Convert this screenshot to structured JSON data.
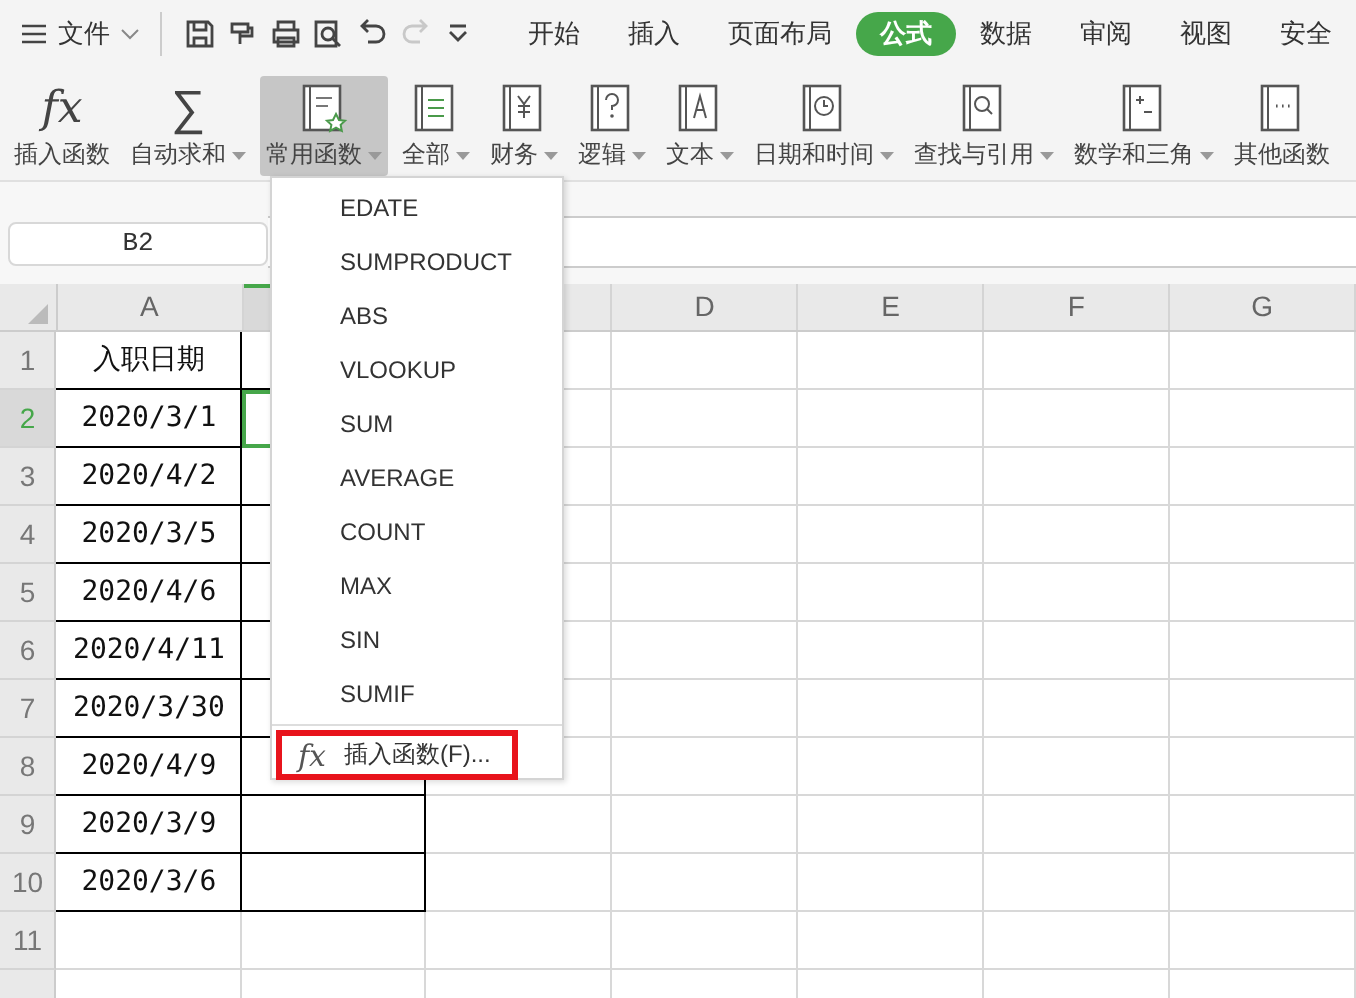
{
  "menu": {
    "label": "文件"
  },
  "quick_access": [
    {
      "kind": "save",
      "disabled": false
    },
    {
      "kind": "painter",
      "disabled": false
    },
    {
      "kind": "print",
      "disabled": false
    },
    {
      "kind": "preview",
      "disabled": false
    },
    {
      "kind": "undo",
      "disabled": false
    },
    {
      "kind": "redo",
      "disabled": true
    },
    {
      "kind": "more",
      "disabled": false
    }
  ],
  "tabs": [
    {
      "label": "开始",
      "selected": false
    },
    {
      "label": "插入",
      "selected": false
    },
    {
      "label": "页面布局",
      "selected": false
    },
    {
      "label": "公式",
      "selected": true
    },
    {
      "label": "数据",
      "selected": false
    },
    {
      "label": "审阅",
      "selected": false
    },
    {
      "label": "视图",
      "selected": false
    },
    {
      "label": "安全",
      "selected": false
    }
  ],
  "ribbon": [
    {
      "kind": "fx",
      "glyph": "fx",
      "label": "插入函数",
      "dropdown": false,
      "selected": false
    },
    {
      "kind": "sum",
      "glyph": "∑",
      "label": "自动求和",
      "dropdown": true,
      "selected": false
    },
    {
      "kind": "common",
      "label": "常用函数",
      "dropdown": true,
      "selected": true
    },
    {
      "kind": "all",
      "label": "全部",
      "dropdown": true,
      "selected": false
    },
    {
      "kind": "finance",
      "label": "财务",
      "dropdown": true,
      "selected": false
    },
    {
      "kind": "logic",
      "label": "逻辑",
      "dropdown": true,
      "selected": false
    },
    {
      "kind": "text",
      "label": "文本",
      "dropdown": true,
      "selected": false
    },
    {
      "kind": "datetime",
      "label": "日期和时间",
      "dropdown": true,
      "selected": false
    },
    {
      "kind": "lookup",
      "label": "查找与引用",
      "dropdown": true,
      "selected": false
    },
    {
      "kind": "math",
      "label": "数学和三角",
      "dropdown": true,
      "selected": false
    },
    {
      "kind": "other",
      "label": "其他函数",
      "dropdown": false,
      "selected": false
    }
  ],
  "name_box": {
    "value": "B2"
  },
  "sheet": {
    "columns": [
      {
        "label": "A",
        "selected": false
      },
      {
        "selected": true
      },
      {
        "selected": false
      },
      {
        "label": "D",
        "selected": false
      },
      {
        "label": "E",
        "selected": false
      },
      {
        "label": "F",
        "selected": false
      },
      {
        "label": "G",
        "selected": false
      }
    ],
    "rows": [
      {
        "label": "1",
        "selected": false,
        "cells": [
          "入职日期"
        ]
      },
      {
        "label": "2",
        "selected": true,
        "cells": [
          "2020/3/1"
        ]
      },
      {
        "label": "3",
        "selected": false,
        "cells": [
          "2020/4/2"
        ]
      },
      {
        "label": "4",
        "selected": false,
        "cells": [
          "2020/3/5"
        ]
      },
      {
        "label": "5",
        "selected": false,
        "cells": [
          "2020/4/6"
        ]
      },
      {
        "label": "6",
        "selected": false,
        "cells": [
          "2020/4/11"
        ]
      },
      {
        "label": "7",
        "selected": false,
        "cells": [
          "2020/3/30"
        ]
      },
      {
        "label": "8",
        "selected": false,
        "cells": [
          "2020/4/9"
        ]
      },
      {
        "label": "9",
        "selected": false,
        "cells": [
          "2020/3/9"
        ]
      },
      {
        "label": "10",
        "selected": false,
        "cells": [
          "2020/3/6"
        ]
      },
      {
        "label": "11",
        "selected": false,
        "cells": []
      },
      {
        "selected": false,
        "cells": []
      }
    ]
  },
  "dropdown": {
    "items": [
      "EDATE",
      "SUMPRODUCT",
      "ABS",
      "VLOOKUP",
      "SUM",
      "AVERAGE",
      "COUNT",
      "MAX",
      "SIN",
      "SUMIF"
    ],
    "footer": {
      "glyph": "fx",
      "label": "插入函数(F)...",
      "highlighted": true
    }
  }
}
